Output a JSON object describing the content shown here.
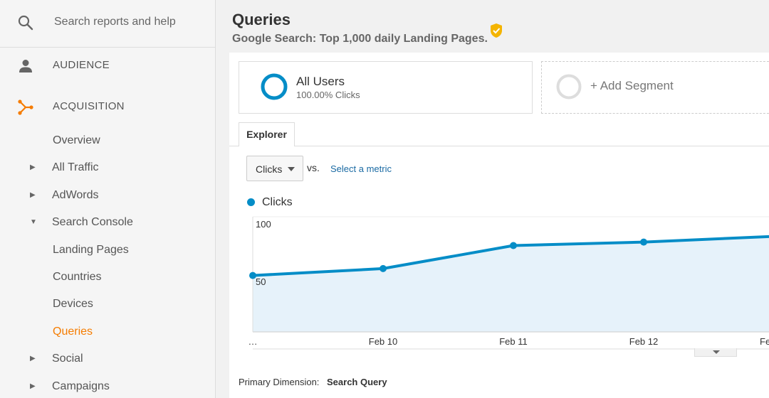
{
  "sidebar": {
    "search_placeholder": "Search reports and help",
    "sections": [
      {
        "label": "AUDIENCE",
        "icon": "person-icon"
      },
      {
        "label": "ACQUISITION",
        "icon": "acquisition-icon"
      }
    ],
    "items": [
      {
        "label": "Overview",
        "caret": ""
      },
      {
        "label": "All Traffic",
        "caret": "▶"
      },
      {
        "label": "AdWords",
        "caret": "▶"
      },
      {
        "label": "Search Console",
        "caret": "▼"
      },
      {
        "label": "Landing Pages",
        "caret": ""
      },
      {
        "label": "Countries",
        "caret": ""
      },
      {
        "label": "Devices",
        "caret": ""
      },
      {
        "label": "Queries",
        "caret": "",
        "active": true
      },
      {
        "label": "Social",
        "caret": "▶"
      },
      {
        "label": "Campaigns",
        "caret": "▶"
      }
    ]
  },
  "header": {
    "title": "Queries",
    "subtitle": "Google Search: Top 1,000 daily Landing Pages."
  },
  "segments": {
    "primary_name": "All Users",
    "primary_sub": "100.00% Clicks",
    "add_label": "+ Add Segment"
  },
  "tabs": {
    "explorer": "Explorer"
  },
  "controls": {
    "metric": "Clicks",
    "vs": "vs.",
    "select_metric": "Select a metric"
  },
  "legend": {
    "label": "Clicks"
  },
  "primary_dimension": {
    "label": "Primary Dimension:",
    "value": "Search Query"
  },
  "colors": {
    "accent": "#f57c00",
    "series": "#058dc7",
    "area": "#e6f2fa",
    "link": "#1a6aa3"
  },
  "chart_data": {
    "type": "area",
    "x": [
      "…",
      "Feb 10",
      "Feb 11",
      "Feb 12",
      "Fe"
    ],
    "series": [
      {
        "name": "Clicks",
        "values": [
          49,
          55,
          75,
          78,
          83
        ]
      }
    ],
    "y_ticks": [
      "100",
      "50"
    ],
    "ylim": [
      0,
      100
    ],
    "grid": true
  }
}
